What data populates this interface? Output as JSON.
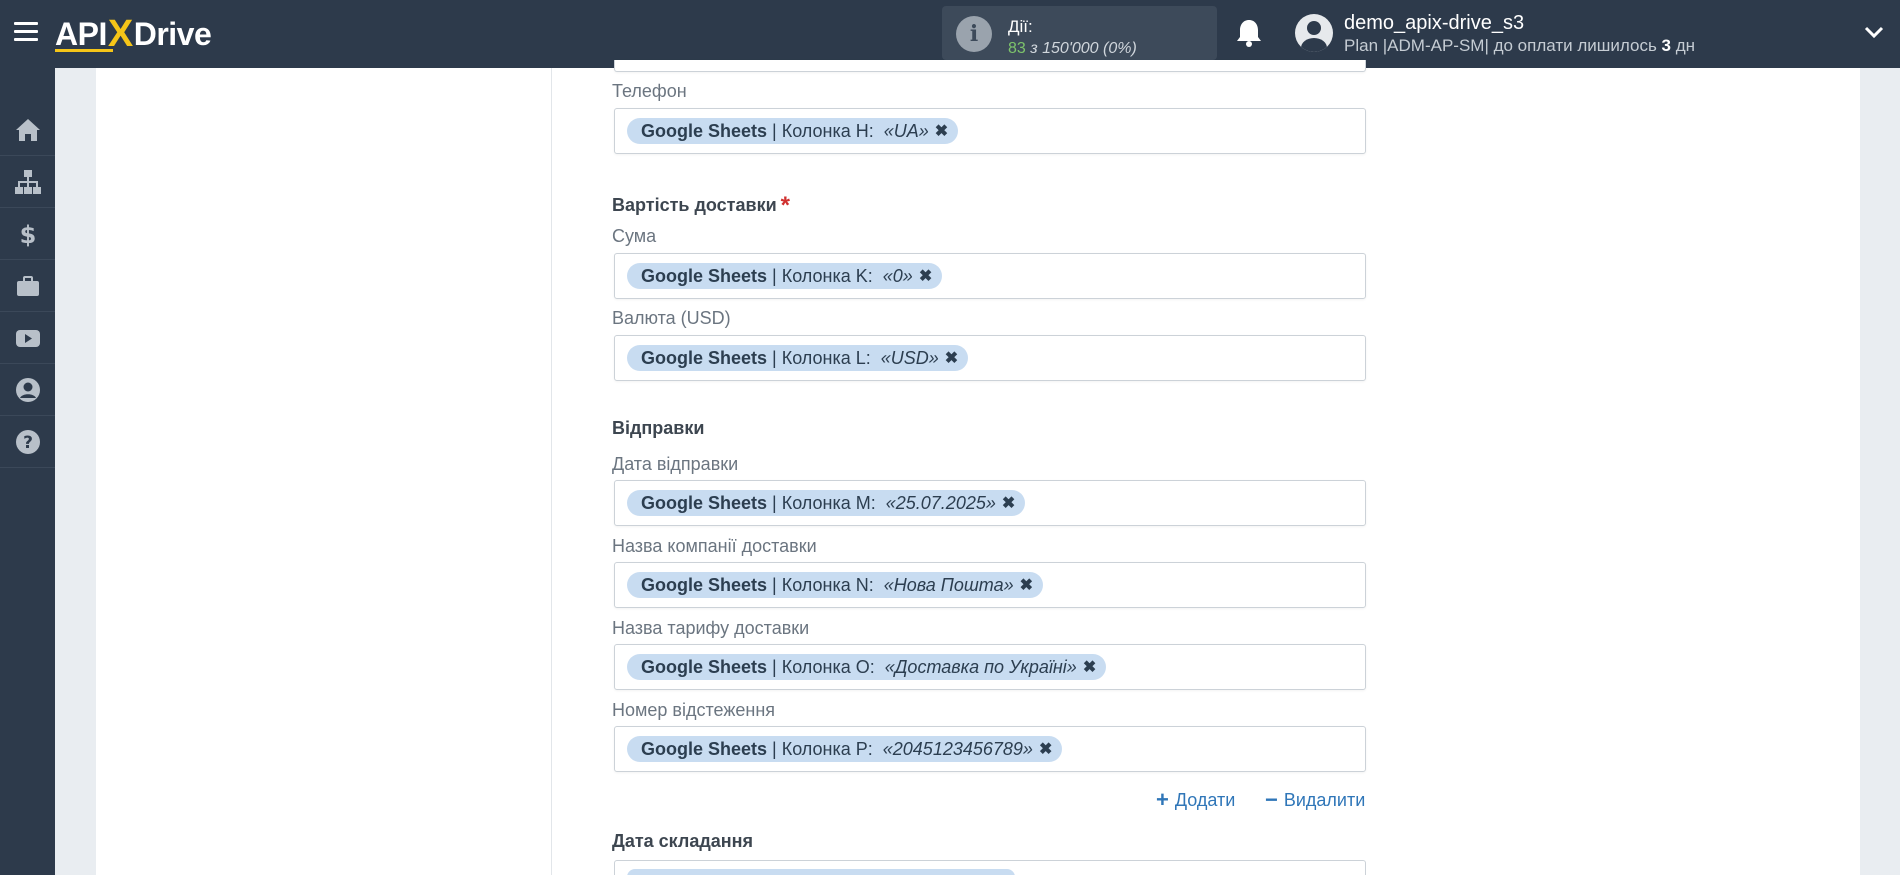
{
  "header": {
    "logo_left": "API",
    "logo_x": "X",
    "logo_right": "Drive",
    "actions_label": "Дії:",
    "actions_count": "83",
    "actions_of": "з 150'000",
    "actions_percent": "(0%)",
    "user_name": "demo_apix-drive_s3",
    "plan_prefix": "Plan |ADM-AP-SM| до оплати лишилось ",
    "plan_days": "3",
    "plan_suffix": " дн"
  },
  "sidebar": {
    "items": [
      "home-icon",
      "sitemap-icon",
      "dollar-icon",
      "briefcase-icon",
      "youtube-icon",
      "user-circle-icon",
      "help-icon"
    ]
  },
  "form": {
    "phone_label": "Телефон",
    "phone_tag": {
      "source": "Google Sheets",
      "column": "| Колонка H:",
      "value": "«UA»"
    },
    "shipping_cost_title": "Вартість доставки",
    "required_mark": "*",
    "amount_label": "Сума",
    "amount_tag": {
      "source": "Google Sheets",
      "column": "| Колонка K:",
      "value": "«0»"
    },
    "currency_label": "Валюта (USD)",
    "currency_tag": {
      "source": "Google Sheets",
      "column": "| Колонка L:",
      "value": "«USD»"
    },
    "shipments_title": "Відправки",
    "ship_date_label": "Дата відправки",
    "ship_date_tag": {
      "source": "Google Sheets",
      "column": "| Колонка M:",
      "value": "«25.07.2025»"
    },
    "carrier_label": "Назва компанії доставки",
    "carrier_tag": {
      "source": "Google Sheets",
      "column": "| Колонка N:",
      "value": "«Нова Пошта»"
    },
    "tariff_label": "Назва тарифу доставки",
    "tariff_tag": {
      "source": "Google Sheets",
      "column": "| Колонка O:",
      "value": "«Доставка по Україні»"
    },
    "tracking_label": "Номер відстеження",
    "tracking_tag": {
      "source": "Google Sheets",
      "column": "| Колонка P:",
      "value": "«2045123456789»"
    },
    "add_label": "Додати",
    "remove_label": "Видалити",
    "compile_date_title": "Дата складання",
    "remove_symbol": "✖"
  },
  "colors": {
    "topbar": "#2d3a4b",
    "tag_bg": "#c8dcf1",
    "link": "#2f76b8",
    "required": "#d0302f",
    "count_green": "#7dc36b"
  }
}
